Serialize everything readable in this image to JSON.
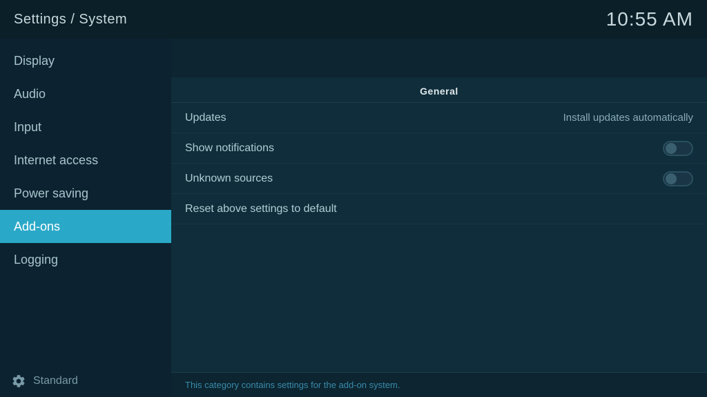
{
  "header": {
    "title": "Settings / System",
    "time": "10:55 AM"
  },
  "sidebar": {
    "items": [
      {
        "id": "display",
        "label": "Display",
        "active": false
      },
      {
        "id": "audio",
        "label": "Audio",
        "active": false
      },
      {
        "id": "input",
        "label": "Input",
        "active": false
      },
      {
        "id": "internet-access",
        "label": "Internet access",
        "active": false
      },
      {
        "id": "power-saving",
        "label": "Power saving",
        "active": false
      },
      {
        "id": "add-ons",
        "label": "Add-ons",
        "active": true
      },
      {
        "id": "logging",
        "label": "Logging",
        "active": false
      }
    ],
    "bottom_label": "Standard"
  },
  "content": {
    "section_title": "General",
    "rows": [
      {
        "id": "updates",
        "label": "Updates",
        "value": "Install updates automatically",
        "has_toggle": false
      },
      {
        "id": "show-notifications",
        "label": "Show notifications",
        "toggle_state": "off",
        "has_toggle": true
      },
      {
        "id": "unknown-sources",
        "label": "Unknown sources",
        "toggle_state": "off",
        "has_toggle": true
      }
    ],
    "reset_label": "Reset above settings to default",
    "footer_text": "This category contains settings for the add-on system."
  }
}
